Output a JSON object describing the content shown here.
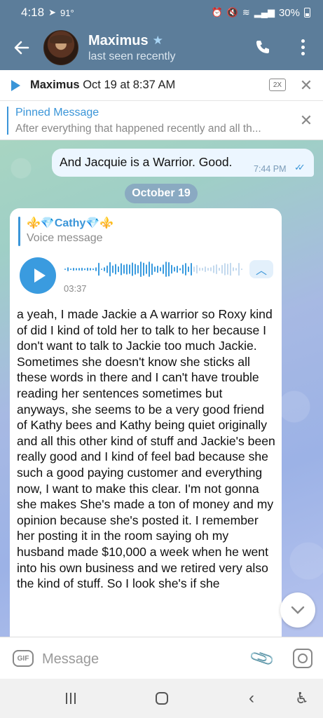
{
  "status_bar": {
    "time": "4:18",
    "temperature": "91°",
    "battery": "30%"
  },
  "header": {
    "contact_name": "Maximus",
    "contact_status": "last seen recently"
  },
  "player": {
    "author": "Maximus",
    "date": "Oct 19 at 8:37 AM",
    "speed": "2X"
  },
  "pinned": {
    "title": "Pinned Message",
    "text": "After everything that happened recently and all th..."
  },
  "messages": {
    "outgoing": {
      "text": "And Jacquie is a Warrior. Good.",
      "time": "7:44 PM"
    },
    "date_separator": "October 19",
    "incoming": {
      "reply_name": "⚜️💎Cathy💎⚜️",
      "reply_sub": "Voice message",
      "duration": "03:37",
      "transcript": "a yeah, I made Jackie a A warrior so Roxy kind of did I kind of told her to talk to her because I don't want to talk to Jackie too much Jackie. Sometimes she doesn't know she sticks all these words in there and I can't have trouble reading her sentences sometimes but anyways, she seems to be a very good friend of Kathy bees and Kathy being quiet originally and all this other kind of stuff and Jackie's been really good and I kind of feel bad because she such a good paying customer and everything now, I want to make this clear. I'm not gonna she makes She's made a ton of money and my opinion because she's posted it. I remember her posting it in the room saying oh my husband made $10,000 a week when he went into his own business and we retired very also the kind of stuff. So I look she's if she"
    }
  },
  "input": {
    "gif_label": "GIF",
    "placeholder": "Message"
  },
  "colors": {
    "header_bg": "#5c7d9a",
    "accent": "#3a95d8"
  }
}
